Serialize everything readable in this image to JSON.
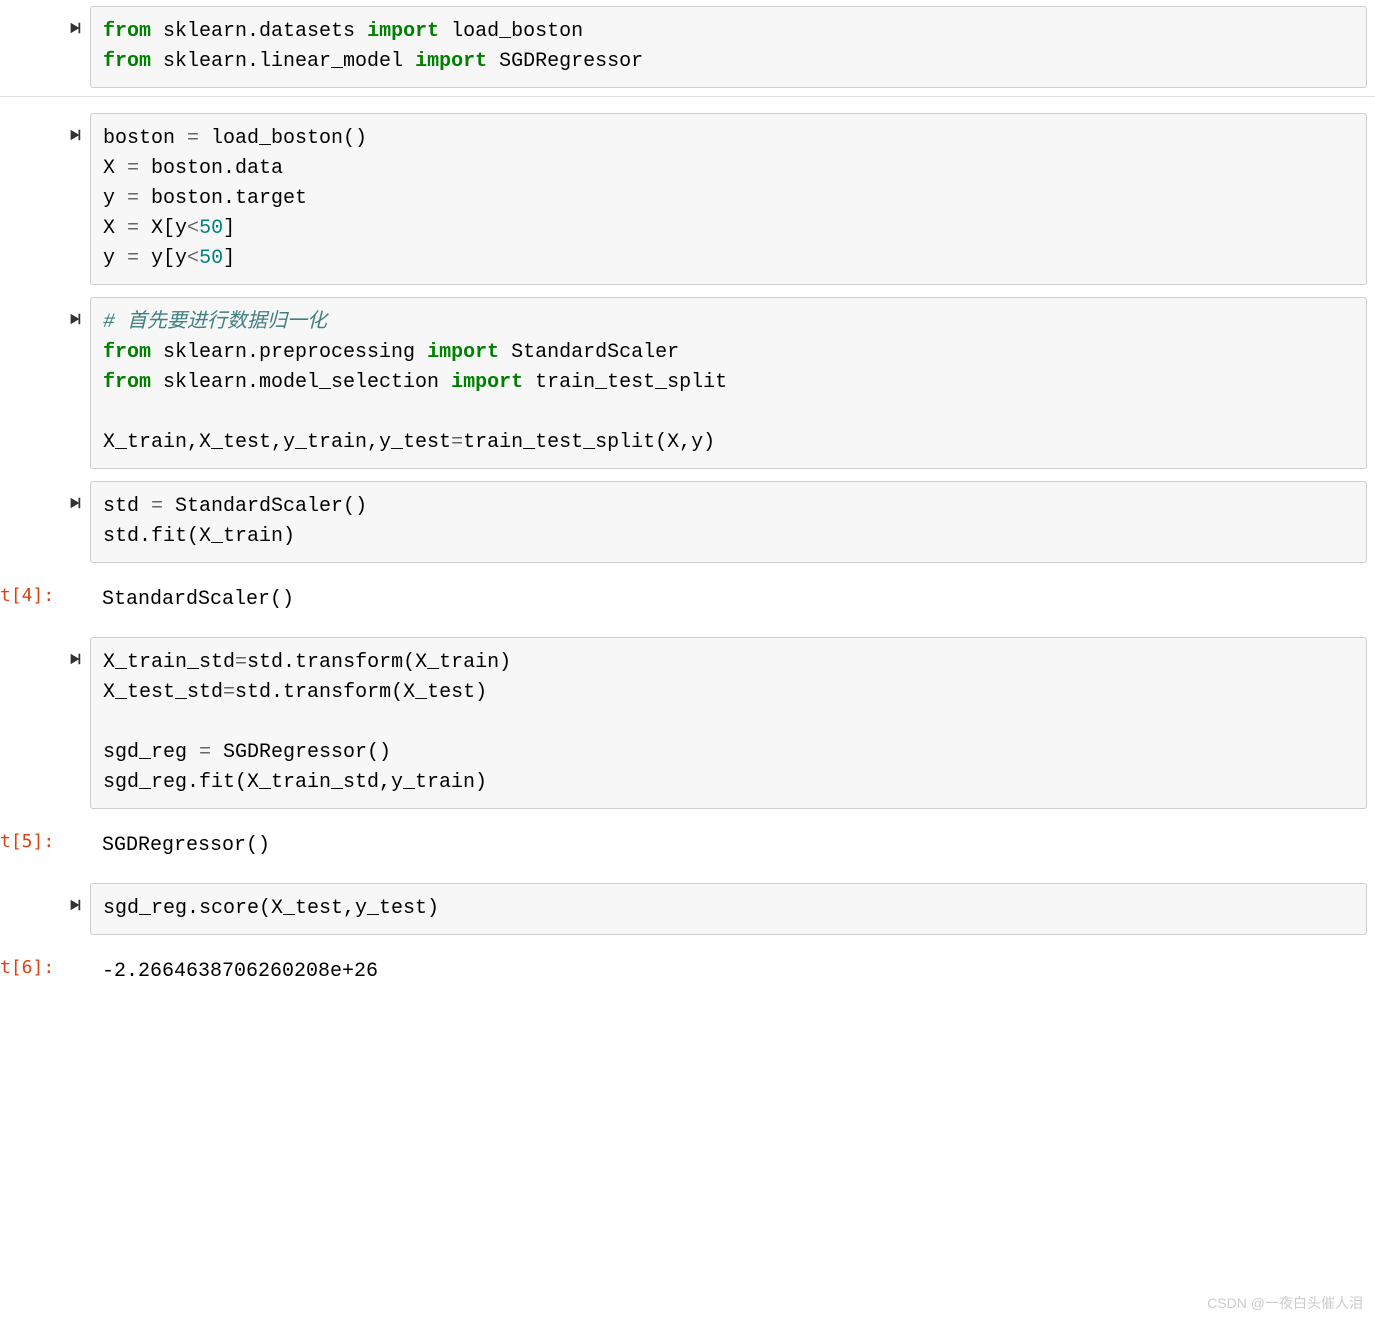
{
  "cells": [
    {
      "type": "code",
      "has_run": true,
      "code_html": "<span class='kw'>from</span> sklearn.datasets <span class='kw'>import</span> load_boston\n<span class='kw'>from</span> sklearn.linear_model <span class='kw'>import</span> SGDRegressor",
      "sep_after": true
    },
    {
      "type": "code",
      "has_run": true,
      "code_html": "boston <span class='op'>=</span> load_boston()\nX <span class='op'>=</span> boston.data\ny <span class='op'>=</span> boston.target\nX <span class='op'>=</span> X[y<span class='op'>&lt;</span><span class='num'>50</span>]\ny <span class='op'>=</span> y[y<span class='op'>&lt;</span><span class='num'>50</span>]"
    },
    {
      "type": "code",
      "has_run": true,
      "code_html": "<span class='cmt'># 首先要进行数据归一化</span>\n<span class='kw'>from</span> sklearn.preprocessing <span class='kw'>import</span> StandardScaler\n<span class='kw'>from</span> sklearn.model_selection <span class='kw'>import</span> train_test_split\n\nX_train,X_test,y_train,y_test<span class='op'>=</span>train_test_split(X,y)"
    },
    {
      "type": "code",
      "has_run": true,
      "code_html": "std <span class='op'>=</span> StandardScaler()\nstd.fit(X_train)"
    },
    {
      "type": "output",
      "prompt": "t[4]:",
      "text": "StandardScaler()"
    },
    {
      "type": "code",
      "has_run": true,
      "code_html": "X_train_std<span class='op'>=</span>std.transform(X_train)\nX_test_std<span class='op'>=</span>std.transform(X_test)\n\nsgd_reg <span class='op'>=</span> SGDRegressor()\nsgd_reg.fit(X_train_std,y_train)"
    },
    {
      "type": "output",
      "prompt": "t[5]:",
      "text": "SGDRegressor()"
    },
    {
      "type": "code",
      "has_run": true,
      "code_html": "sgd_reg.score(X_test,y_test)"
    },
    {
      "type": "output",
      "prompt": "t[6]:",
      "text": "-2.2664638706260208e+26"
    }
  ],
  "watermark": "CSDN @一夜白头催人泪"
}
